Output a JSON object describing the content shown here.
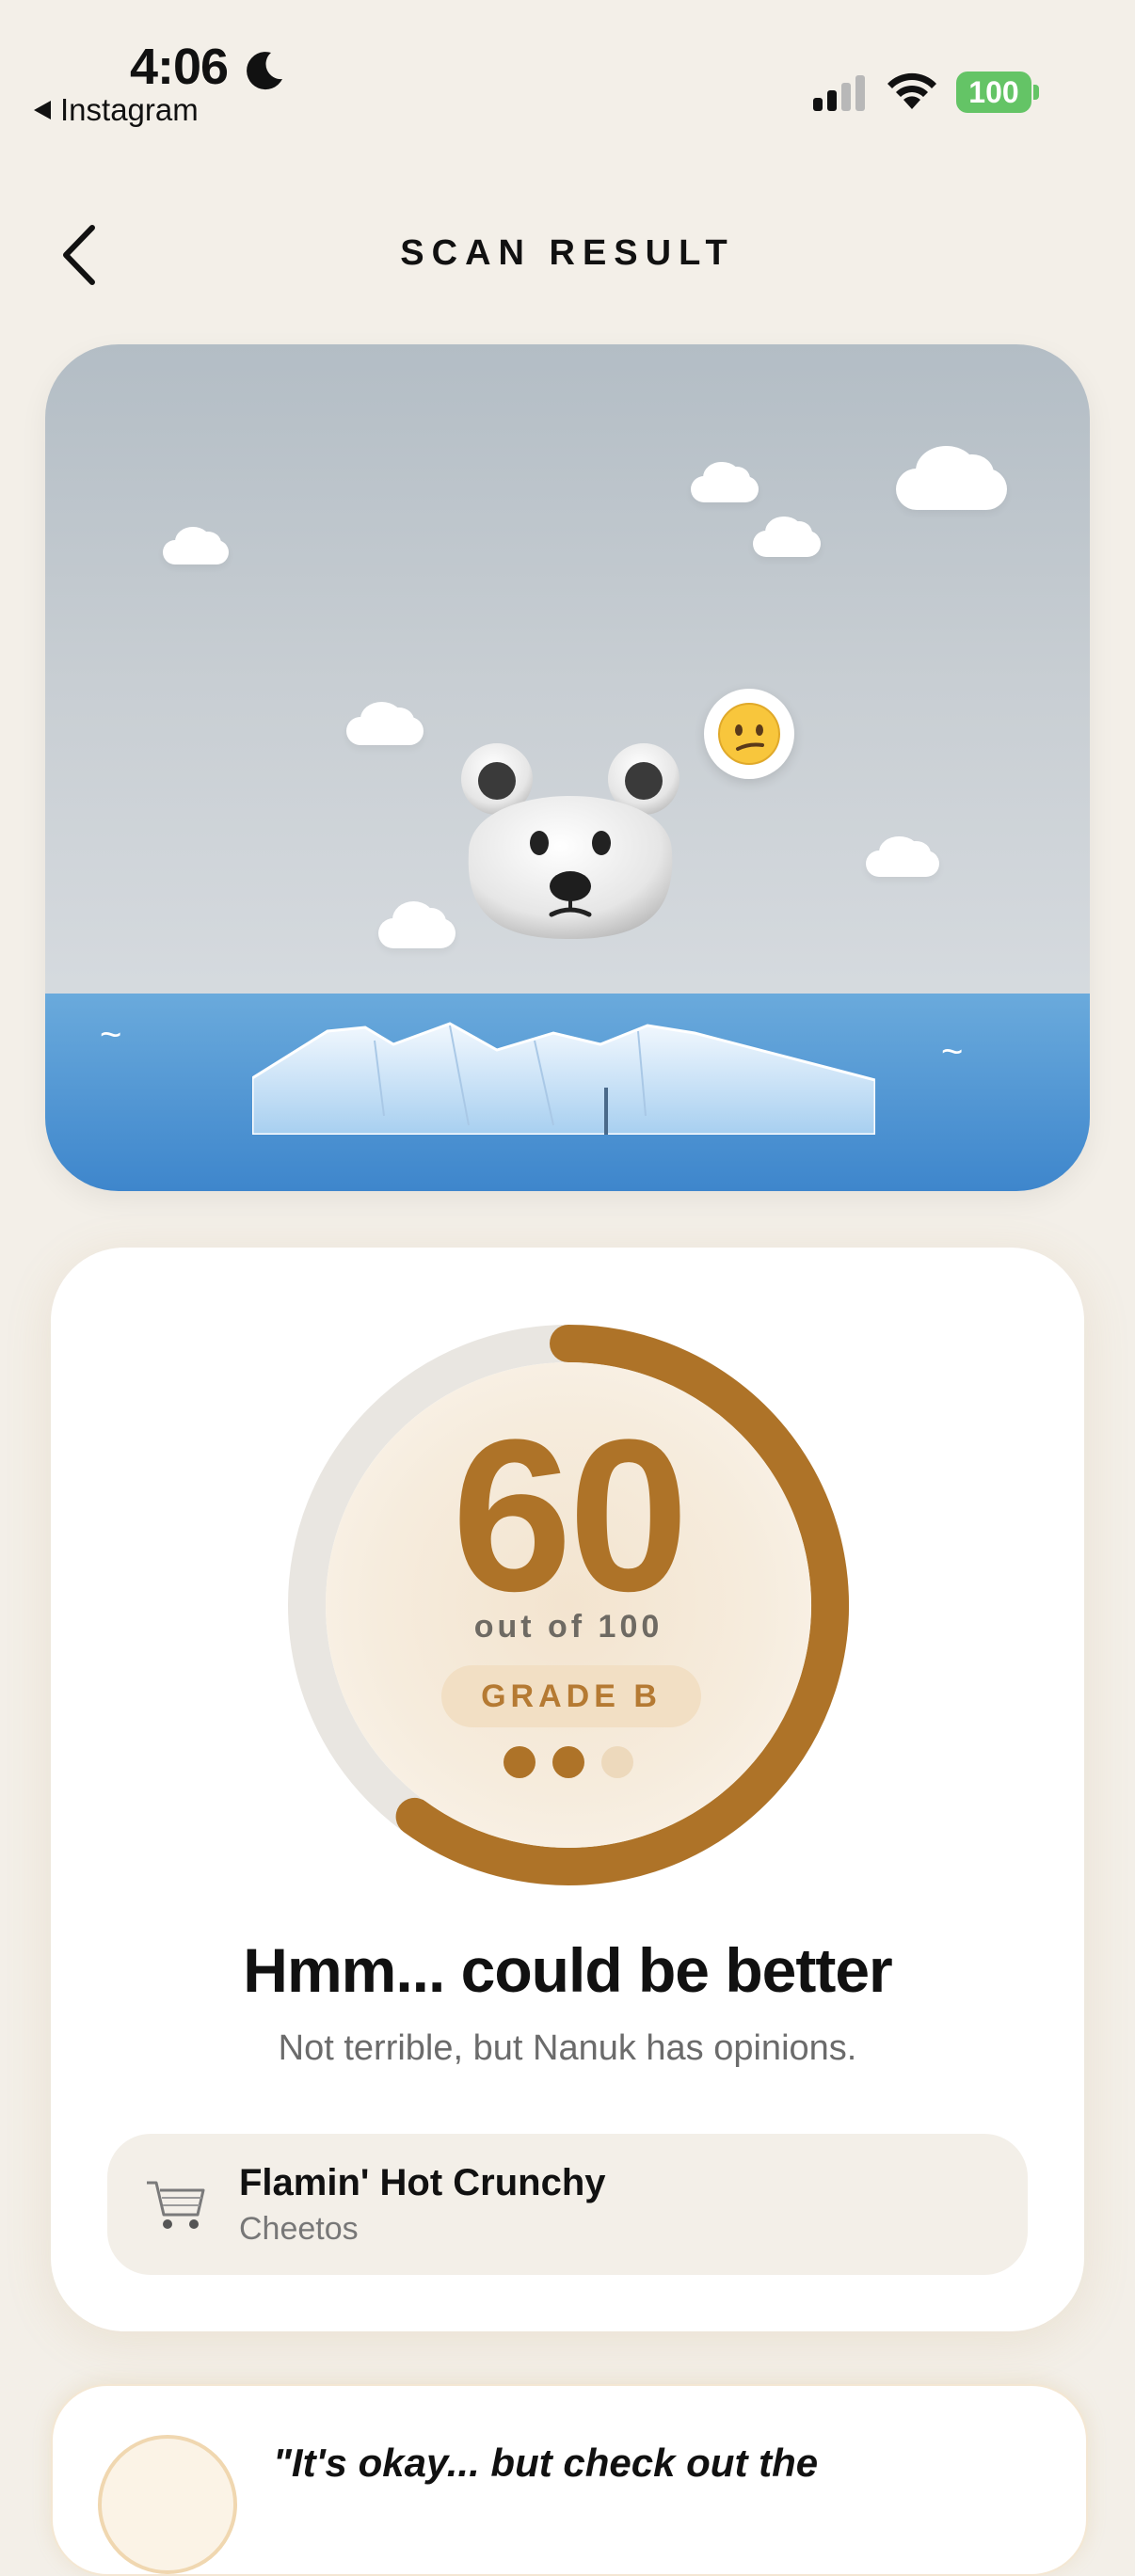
{
  "status_bar": {
    "time": "4:06",
    "back_app": "Instagram",
    "battery": "100",
    "moon_icon": "moon-icon",
    "signal_icon": "cellular-signal-icon",
    "wifi_icon": "wifi-icon"
  },
  "header": {
    "title": "SCAN RESULT",
    "back_icon": "chevron-left-icon"
  },
  "scene": {
    "character": "polar-bear",
    "mood_emoji": "😕",
    "sky_color": "#BFC7CE",
    "sea_color": "#4E93D2",
    "wave_glyph": "~"
  },
  "score": {
    "value": "60",
    "max_label": "out of 100",
    "grade_label": "GRADE B",
    "progress_fraction": 0.6,
    "filled_dots": 2,
    "total_dots": 3,
    "accent_color": "#AE7328",
    "headline": "Hmm... could be better",
    "subline": "Not terrible, but Nanuk has opinions."
  },
  "product": {
    "icon": "shopping-cart-icon",
    "name": "Flamin' Hot Crunchy",
    "brand": "Cheetos"
  },
  "quote": {
    "text": "\"It's okay... but check out the"
  }
}
